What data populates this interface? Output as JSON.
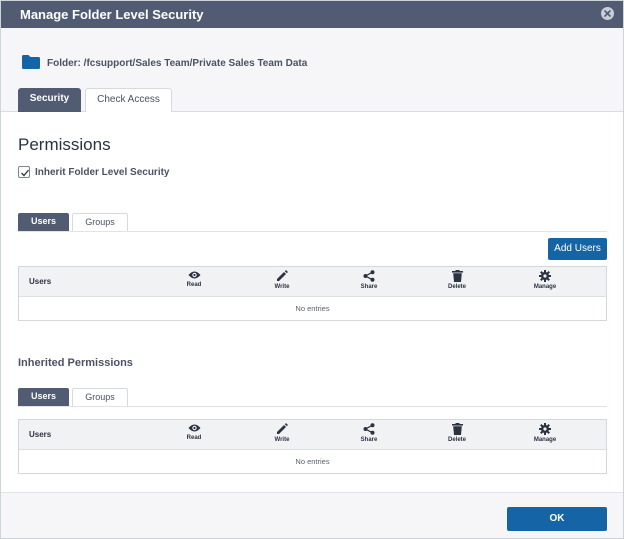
{
  "dialog": {
    "title": "Manage Folder Level Security",
    "close_icon": "close-icon"
  },
  "folder": {
    "icon": "folder-icon",
    "label": "Folder: /fcsupport/Sales Team/Private Sales Team Data"
  },
  "top_tabs": [
    {
      "label": "Security",
      "active": true
    },
    {
      "label": "Check Access",
      "active": false
    }
  ],
  "permissions": {
    "heading": "Permissions",
    "inherit_checkbox": {
      "label": "Inherit Folder Level Security",
      "checked": true
    },
    "sub_tabs": [
      {
        "label": "Users",
        "active": true
      },
      {
        "label": "Groups",
        "active": false
      }
    ],
    "add_users_label": "Add Users",
    "table": {
      "first_column": "Users",
      "columns": [
        {
          "label": "Read",
          "icon": "eye-icon"
        },
        {
          "label": "Write",
          "icon": "pencil-icon"
        },
        {
          "label": "Share",
          "icon": "share-icon"
        },
        {
          "label": "Delete",
          "icon": "trash-icon"
        },
        {
          "label": "Manage",
          "icon": "gear-icon"
        }
      ],
      "empty_text": "No entries"
    }
  },
  "inherited": {
    "heading": "Inherited Permissions",
    "sub_tabs": [
      {
        "label": "Users",
        "active": true
      },
      {
        "label": "Groups",
        "active": false
      }
    ],
    "table": {
      "first_column": "Users",
      "columns": [
        {
          "label": "Read",
          "icon": "eye-icon"
        },
        {
          "label": "Write",
          "icon": "pencil-icon"
        },
        {
          "label": "Share",
          "icon": "share-icon"
        },
        {
          "label": "Delete",
          "icon": "trash-icon"
        },
        {
          "label": "Manage",
          "icon": "gear-icon"
        }
      ],
      "empty_text": "No entries"
    }
  },
  "footer": {
    "ok_label": "OK"
  },
  "colors": {
    "titlebar": "#515c73",
    "accent": "#1565a6",
    "active_tab": "#515c73"
  }
}
